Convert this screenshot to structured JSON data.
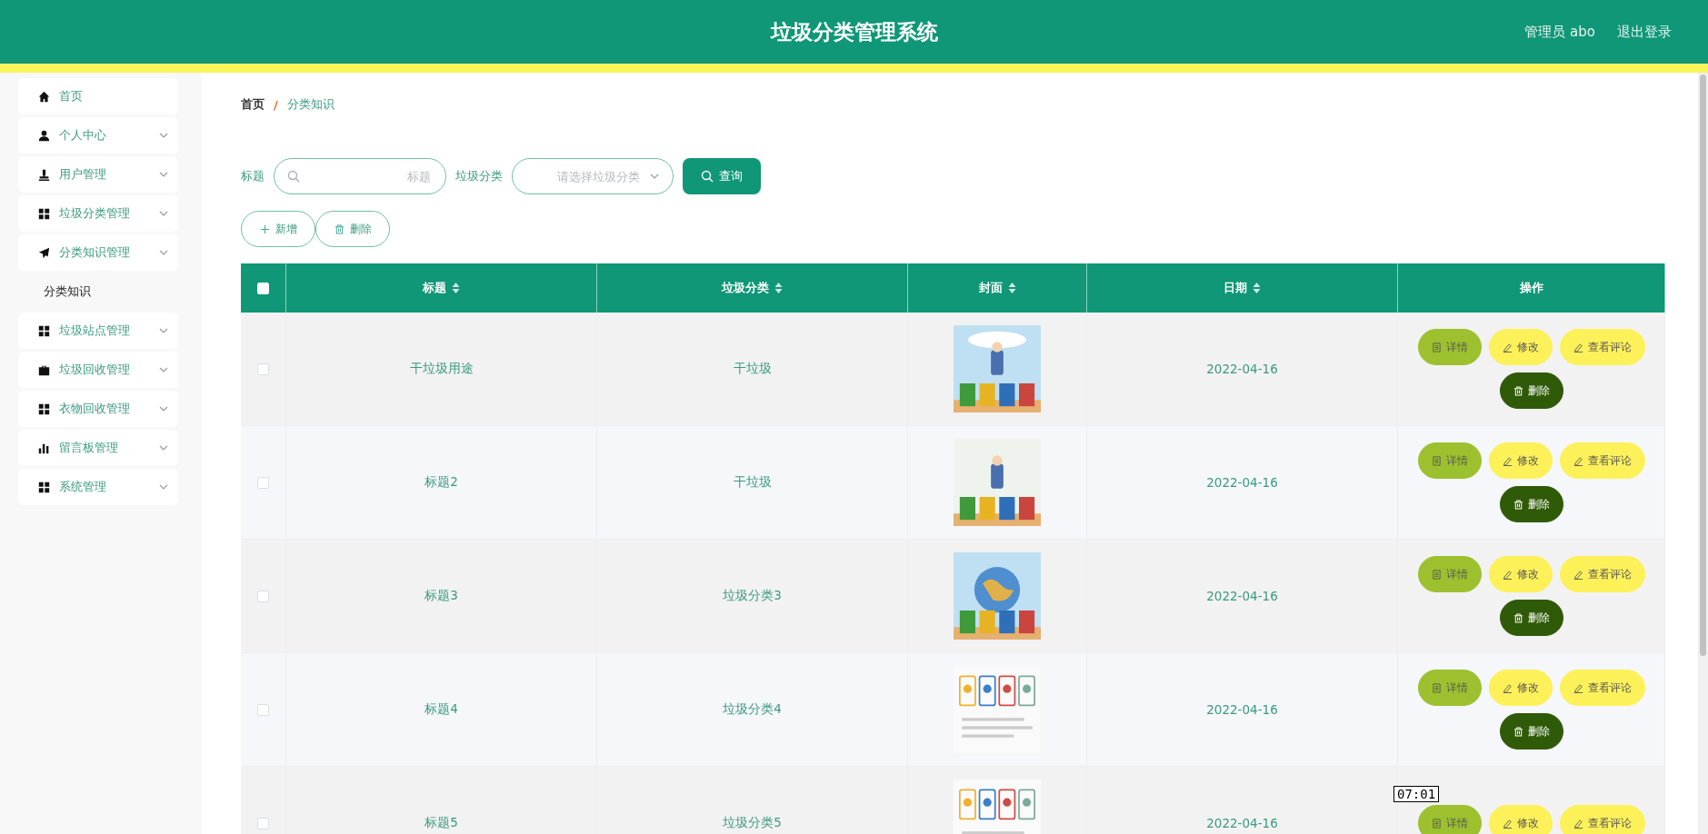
{
  "header": {
    "title": "垃圾分类管理系统",
    "user": "管理员 abo",
    "logout": "退出登录"
  },
  "sidebar": {
    "items": [
      {
        "label": "首页",
        "has_submenu": false
      },
      {
        "label": "个人中心",
        "has_submenu": true
      },
      {
        "label": "用户管理",
        "has_submenu": true
      },
      {
        "label": "垃圾分类管理",
        "has_submenu": true
      },
      {
        "label": "分类知识管理",
        "has_submenu": true,
        "children": [
          {
            "label": "分类知识"
          }
        ]
      },
      {
        "label": "垃圾站点管理",
        "has_submenu": true
      },
      {
        "label": "垃圾回收管理",
        "has_submenu": true
      },
      {
        "label": "衣物回收管理",
        "has_submenu": true
      },
      {
        "label": "留言板管理",
        "has_submenu": true
      },
      {
        "label": "系统管理",
        "has_submenu": true
      }
    ]
  },
  "breadcrumb": {
    "items": [
      "首页",
      "分类知识"
    ],
    "separator": "/"
  },
  "search": {
    "fields": [
      {
        "kind": "text",
        "label": "标题",
        "placeholder": "标题"
      },
      {
        "kind": "select",
        "label": "垃圾分类",
        "placeholder": "请选择垃圾分类"
      }
    ],
    "button": "查询"
  },
  "toolbar": [
    {
      "kind": "add",
      "label": "新增"
    },
    {
      "kind": "delete",
      "label": "删除"
    }
  ],
  "table": {
    "header_checked": false,
    "columns": [
      {
        "label": "标题",
        "sortable": true
      },
      {
        "label": "垃圾分类",
        "sortable": true
      },
      {
        "label": "封面",
        "sortable": true
      },
      {
        "label": "日期",
        "sortable": true
      },
      {
        "label": "操作",
        "sortable": false
      }
    ],
    "rows": [
      {
        "checked": false,
        "title": "干垃圾用途",
        "category": "干垃圾",
        "cover": {
          "kind": "picture"
        },
        "date": "2022-04-16",
        "actions": [
          {
            "kind": "detail",
            "label": "详情"
          },
          {
            "kind": "edit",
            "label": "修改"
          },
          {
            "kind": "comments",
            "label": "查看评论"
          },
          {
            "kind": "delete",
            "label": "删除"
          }
        ]
      },
      {
        "checked": false,
        "title": "标题2",
        "category": "干垃圾",
        "cover": {
          "kind": "picture"
        },
        "date": "2022-04-16",
        "actions": [
          {
            "kind": "detail",
            "label": "详情"
          },
          {
            "kind": "edit",
            "label": "修改"
          },
          {
            "kind": "comments",
            "label": "查看评论"
          },
          {
            "kind": "delete",
            "label": "删除"
          }
        ]
      },
      {
        "checked": false,
        "title": "标题3",
        "category": "垃圾分类3",
        "cover": {
          "kind": "picture"
        },
        "date": "2022-04-16",
        "actions": [
          {
            "kind": "detail",
            "label": "详情"
          },
          {
            "kind": "edit",
            "label": "修改"
          },
          {
            "kind": "comments",
            "label": "查看评论"
          },
          {
            "kind": "delete",
            "label": "删除"
          }
        ]
      },
      {
        "checked": false,
        "title": "标题4",
        "category": "垃圾分类4",
        "cover": {
          "kind": "picture"
        },
        "date": "2022-04-16",
        "actions": [
          {
            "kind": "detail",
            "label": "详情"
          },
          {
            "kind": "edit",
            "label": "修改"
          },
          {
            "kind": "comments",
            "label": "查看评论"
          },
          {
            "kind": "delete",
            "label": "删除"
          }
        ]
      },
      {
        "checked": false,
        "title": "标题5",
        "category": "垃圾分类5",
        "cover": {
          "kind": "picture"
        },
        "date": "2022-04-16",
        "actions": [
          {
            "kind": "detail",
            "label": "详情"
          },
          {
            "kind": "edit",
            "label": "修改"
          },
          {
            "kind": "comments",
            "label": "查看评论"
          }
        ]
      }
    ]
  },
  "tooltip": "07:01"
}
